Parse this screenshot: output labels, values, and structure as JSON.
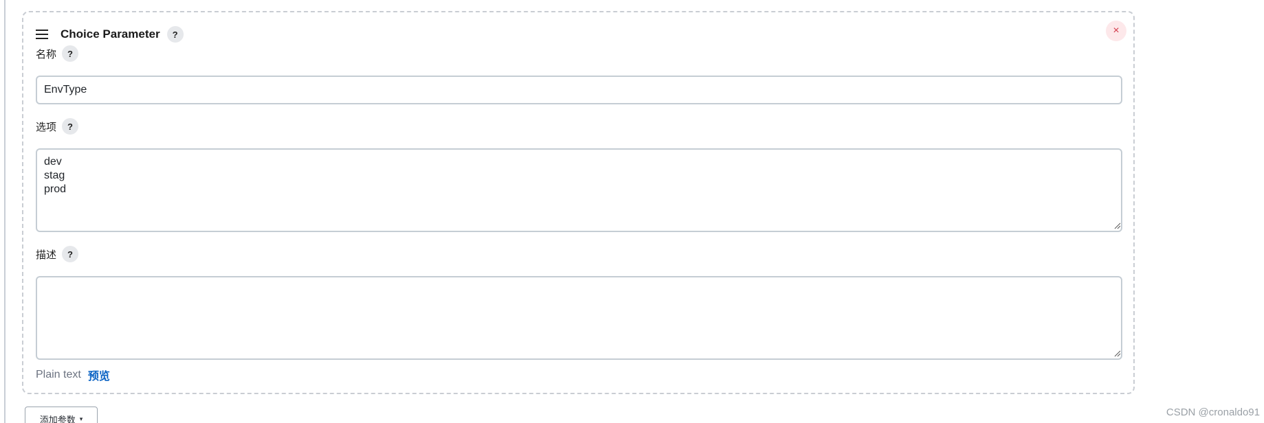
{
  "card": {
    "title": "Choice Parameter",
    "help": "?",
    "close": "×"
  },
  "fields": {
    "name": {
      "label": "名称",
      "help": "?",
      "value": "EnvType"
    },
    "choices": {
      "label": "选项",
      "help": "?",
      "value": "dev\nstag\nprod"
    },
    "description": {
      "label": "描述",
      "help": "?",
      "value": ""
    }
  },
  "footer": {
    "plain_text": "Plain text",
    "preview": "预览"
  },
  "add_param": {
    "label": "添加参数",
    "caret": "▾"
  },
  "watermark": "CSDN @cronaldo91",
  "colors": {
    "accent_link": "#0b63c4",
    "close_red": "#d33a4a",
    "close_bg": "#fde8ea",
    "border": "#c5cdd4"
  },
  "icons": {
    "drag": "drag-handle-icon",
    "help": "question-mark-icon",
    "close": "close-icon",
    "caret": "caret-down-icon",
    "resize": "resize-grip-icon"
  }
}
